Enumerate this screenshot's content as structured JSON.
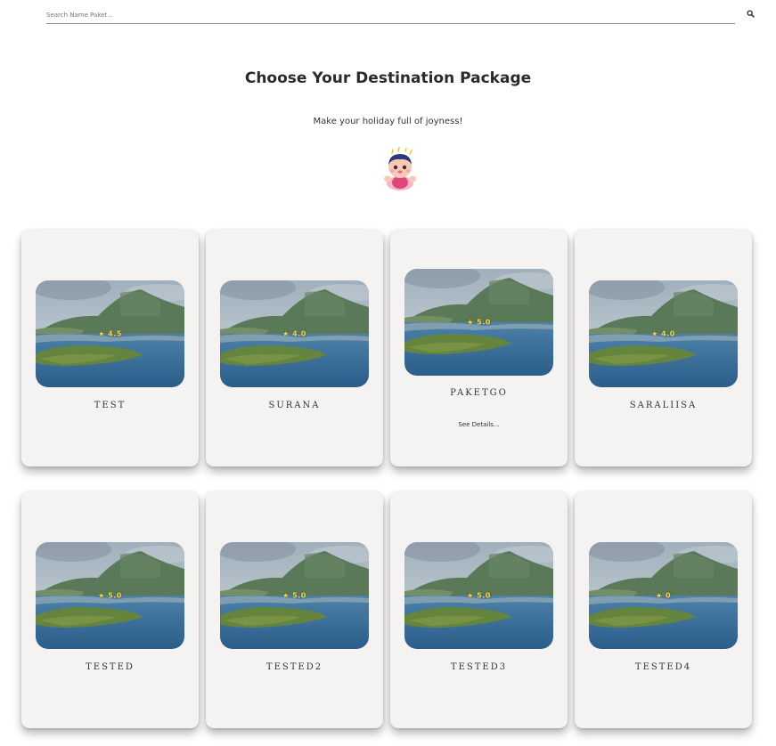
{
  "search": {
    "placeholder": "Search Name Paket..."
  },
  "header": {
    "title": "Choose Your Destination Package",
    "subtitle": "Make your holiday full of joyness!"
  },
  "packages": [
    {
      "name": "TEST",
      "rating": "★ 4.5"
    },
    {
      "name": "SURANA",
      "rating": "★ 4.0"
    },
    {
      "name": "PAKETGO",
      "rating": "★ 5.0",
      "details_label": "See Details..."
    },
    {
      "name": "SARALIISA",
      "rating": "★ 4.0"
    },
    {
      "name": "TESTED",
      "rating": "★ 5.0"
    },
    {
      "name": "TESTED2",
      "rating": "★ 5.0"
    },
    {
      "name": "TESTED3",
      "rating": "★ 5.0"
    },
    {
      "name": "TESTED4",
      "rating": "★ 0"
    }
  ],
  "colors": {
    "rating_star": "#ffd335",
    "card_bg": "#f5f2f2",
    "title": "#2b2b2b"
  },
  "icons": {
    "search": "search-icon",
    "mascot": "mascot-illustration"
  }
}
